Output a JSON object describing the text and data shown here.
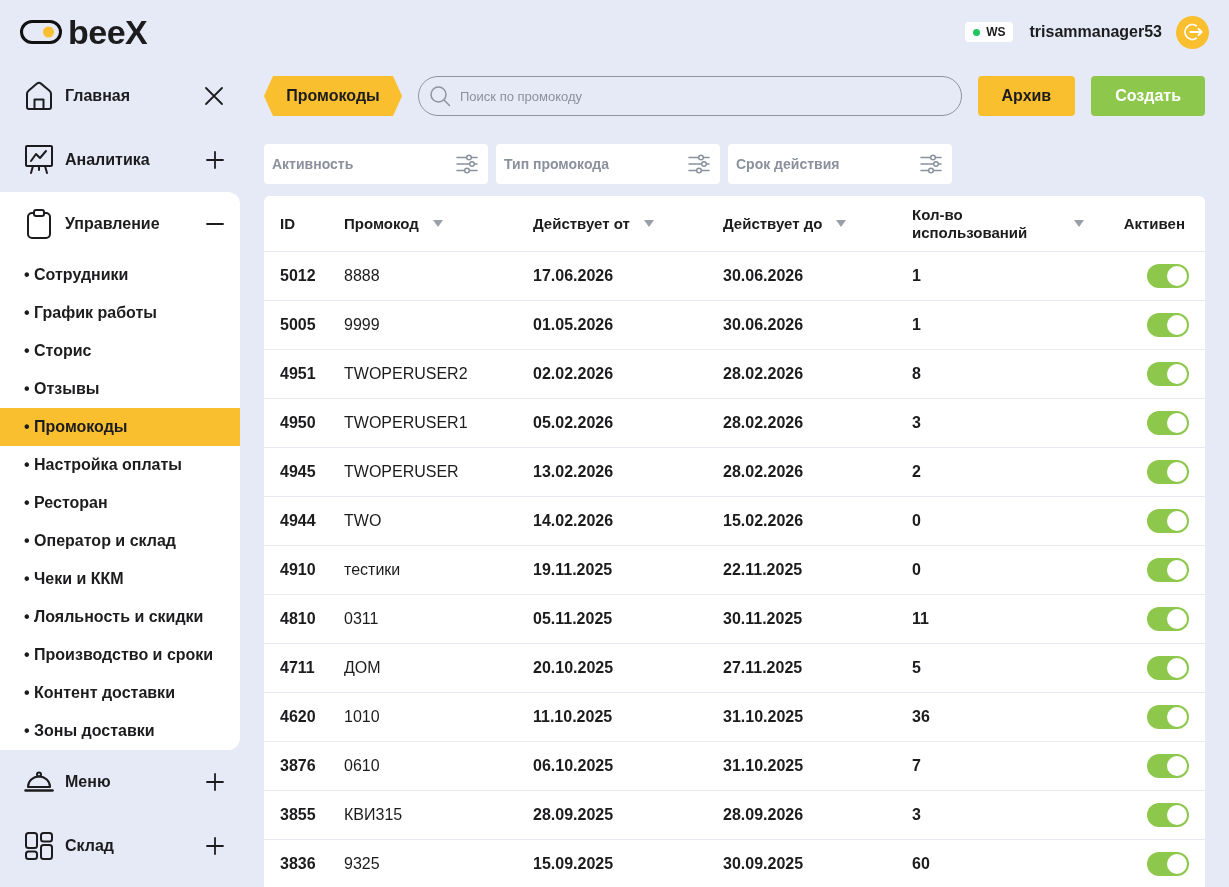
{
  "header": {
    "logo": "beeX",
    "connection": {
      "label": "WS",
      "connected": true
    },
    "user": "trisammanager53"
  },
  "sidebar": {
    "sections": [
      {
        "label": "Главная",
        "kind": "link"
      },
      {
        "label": "Аналитика",
        "kind": "group",
        "expanded": false
      },
      {
        "label": "Управление",
        "kind": "group",
        "expanded": true,
        "children": [
          {
            "label": "• Сотрудники",
            "selected": false
          },
          {
            "label": "• График работы",
            "selected": false
          },
          {
            "label": "• Сторис",
            "selected": false
          },
          {
            "label": "• Отзывы",
            "selected": false
          },
          {
            "label": "• Промокоды",
            "selected": true
          },
          {
            "label": "• Настройка оплаты",
            "selected": false
          },
          {
            "label": "• Ресторан",
            "selected": false
          },
          {
            "label": "• Оператор и склад",
            "selected": false
          },
          {
            "label": "• Чеки и ККМ",
            "selected": false
          },
          {
            "label": "• Лояльность и скидки",
            "selected": false
          },
          {
            "label": "• Производство и сроки",
            "selected": false
          },
          {
            "label": "• Контент доставки",
            "selected": false
          },
          {
            "label": "• Зоны доставки",
            "selected": false
          }
        ]
      },
      {
        "label": "Меню",
        "kind": "group",
        "expanded": false
      },
      {
        "label": "Склад",
        "kind": "group",
        "expanded": false
      }
    ]
  },
  "toolbar": {
    "section_tag": "Промокоды",
    "search": {
      "placeholder": "Поиск по промокоду"
    },
    "buttons": [
      {
        "label": "Архив",
        "kind": "secondary"
      },
      {
        "label": "Создать",
        "kind": "primary"
      }
    ]
  },
  "filters": [
    {
      "label": "Активность"
    },
    {
      "label": "Тип промокода"
    },
    {
      "label": "Срок действия"
    }
  ],
  "table": {
    "columns": [
      {
        "label": "ID",
        "sortable": false
      },
      {
        "label": "Промокод",
        "sortable": true
      },
      {
        "label": "Действует от",
        "sortable": true
      },
      {
        "label": "Действует до",
        "sortable": true
      },
      {
        "label": "Кол-во использований",
        "sortable": true
      },
      {
        "label": "Активен",
        "sortable": false
      }
    ],
    "rows": [
      {
        "id": "5012",
        "code": "8888",
        "valid_from": "17.06.2026",
        "valid_to": "30.06.2026",
        "uses": "1",
        "active": true
      },
      {
        "id": "5005",
        "code": "9999",
        "valid_from": "01.05.2026",
        "valid_to": "30.06.2026",
        "uses": "1",
        "active": true
      },
      {
        "id": "4951",
        "code": "TWOPERUSER2",
        "valid_from": "02.02.2026",
        "valid_to": "28.02.2026",
        "uses": "8",
        "active": true
      },
      {
        "id": "4950",
        "code": "TWOPERUSER1",
        "valid_from": "05.02.2026",
        "valid_to": "28.02.2026",
        "uses": "3",
        "active": true
      },
      {
        "id": "4945",
        "code": "TWOPERUSER",
        "valid_from": "13.02.2026",
        "valid_to": "28.02.2026",
        "uses": "2",
        "active": true
      },
      {
        "id": "4944",
        "code": "TWO",
        "valid_from": "14.02.2026",
        "valid_to": "15.02.2026",
        "uses": "0",
        "active": true
      },
      {
        "id": "4910",
        "code": "тестики",
        "valid_from": "19.11.2025",
        "valid_to": "22.11.2025",
        "uses": "0",
        "active": true
      },
      {
        "id": "4810",
        "code": "0311",
        "valid_from": "05.11.2025",
        "valid_to": "30.11.2025",
        "uses": "11",
        "active": true
      },
      {
        "id": "4711",
        "code": "ДОМ",
        "valid_from": "20.10.2025",
        "valid_to": "27.11.2025",
        "uses": "5",
        "active": true
      },
      {
        "id": "4620",
        "code": "1010",
        "valid_from": "11.10.2025",
        "valid_to": "31.10.2025",
        "uses": "36",
        "active": true
      },
      {
        "id": "3876",
        "code": "0610",
        "valid_from": "06.10.2025",
        "valid_to": "31.10.2025",
        "uses": "7",
        "active": true
      },
      {
        "id": "3855",
        "code": "КВИ315",
        "valid_from": "28.09.2025",
        "valid_to": "28.09.2026",
        "uses": "3",
        "active": true
      },
      {
        "id": "3836",
        "code": "9325",
        "valid_from": "15.09.2025",
        "valid_to": "30.09.2025",
        "uses": "60",
        "active": true
      }
    ]
  }
}
